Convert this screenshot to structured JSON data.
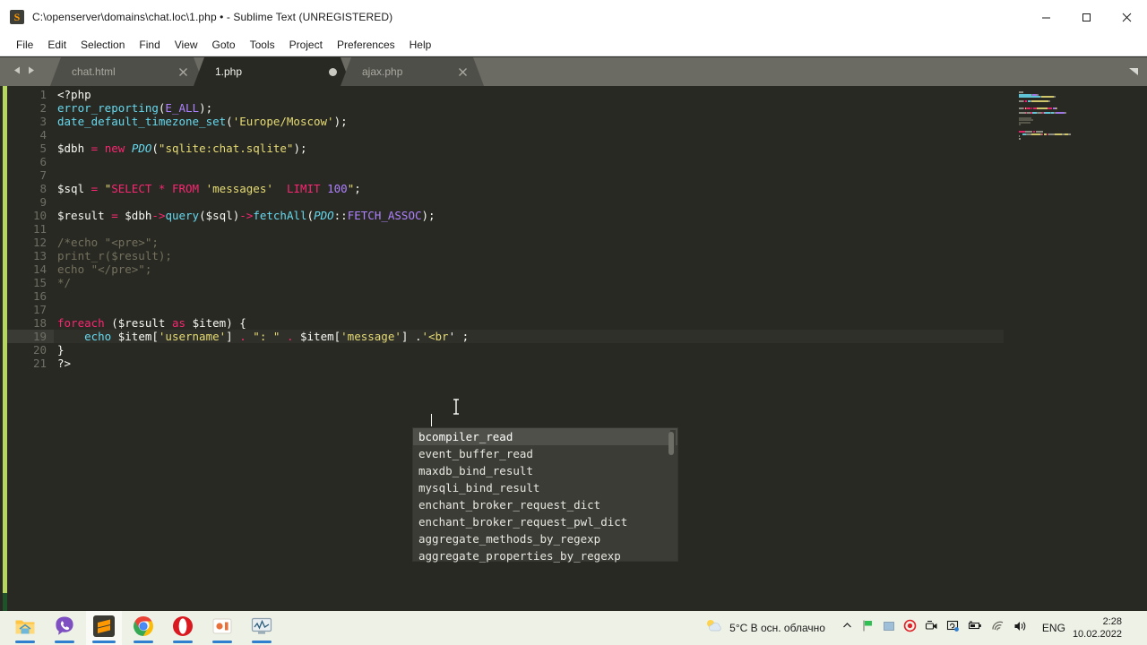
{
  "window": {
    "title": "C:\\openserver\\domains\\chat.loc\\1.php • - Sublime Text (UNREGISTERED)",
    "app_icon": "sublime-text-icon",
    "controls": {
      "minimize": "minimize-icon",
      "maximize": "maximize-icon",
      "close": "close-icon"
    }
  },
  "menubar": {
    "items": [
      {
        "label": "File"
      },
      {
        "label": "Edit"
      },
      {
        "label": "Selection"
      },
      {
        "label": "Find"
      },
      {
        "label": "View"
      },
      {
        "label": "Goto"
      },
      {
        "label": "Tools"
      },
      {
        "label": "Project"
      },
      {
        "label": "Preferences"
      },
      {
        "label": "Help"
      }
    ]
  },
  "tabbar": {
    "nav_prev_icon": "chevron-left-icon",
    "nav_next_icon": "chevron-right-icon",
    "overflow_icon": "chevron-down-icon",
    "tabs": [
      {
        "label": "chat.html",
        "active": false,
        "dirty": false,
        "close_icon": "close-icon"
      },
      {
        "label": "1.php",
        "active": true,
        "dirty": true,
        "close_icon": "dirty-dot-icon"
      },
      {
        "label": "ajax.php",
        "active": false,
        "dirty": false,
        "close_icon": "close-icon"
      }
    ]
  },
  "editor": {
    "active_line": 19,
    "cursor_column_text": "after <br",
    "lines": [
      {
        "n": "1",
        "tokens": [
          {
            "t": "def",
            "s": "<?php"
          }
        ]
      },
      {
        "n": "2",
        "tokens": [
          {
            "t": "fn",
            "s": "error_reporting"
          },
          {
            "t": "punct",
            "s": "("
          },
          {
            "t": "const",
            "s": "E_ALL"
          },
          {
            "t": "punct",
            "s": ");"
          }
        ]
      },
      {
        "n": "3",
        "tokens": [
          {
            "t": "fn",
            "s": "date_default_timezone_set"
          },
          {
            "t": "punct",
            "s": "("
          },
          {
            "t": "str",
            "s": "'Europe/Moscow'"
          },
          {
            "t": "punct",
            "s": ");"
          }
        ]
      },
      {
        "n": "4",
        "tokens": []
      },
      {
        "n": "5",
        "tokens": [
          {
            "t": "var",
            "s": "$dbh "
          },
          {
            "t": "op",
            "s": "="
          },
          {
            "t": "var",
            "s": " "
          },
          {
            "t": "kw",
            "s": "new"
          },
          {
            "t": "var",
            "s": " "
          },
          {
            "t": "cls",
            "s": "PDO"
          },
          {
            "t": "punct",
            "s": "("
          },
          {
            "t": "str",
            "s": "\"sqlite:chat.sqlite\""
          },
          {
            "t": "punct",
            "s": ");"
          }
        ]
      },
      {
        "n": "6",
        "tokens": []
      },
      {
        "n": "7",
        "tokens": []
      },
      {
        "n": "8",
        "tokens": [
          {
            "t": "var",
            "s": "$sql "
          },
          {
            "t": "op",
            "s": "="
          },
          {
            "t": "var",
            "s": " "
          },
          {
            "t": "str",
            "s": "\""
          },
          {
            "t": "kw",
            "s": "SELECT"
          },
          {
            "t": "str",
            "s": " "
          },
          {
            "t": "op",
            "s": "*"
          },
          {
            "t": "str",
            "s": " "
          },
          {
            "t": "kw",
            "s": "FROM"
          },
          {
            "t": "str",
            "s": " 'messages'  "
          },
          {
            "t": "kw",
            "s": "LIMIT"
          },
          {
            "t": "str",
            "s": " "
          },
          {
            "t": "const",
            "s": "100"
          },
          {
            "t": "str",
            "s": "\""
          },
          {
            "t": "punct",
            "s": ";"
          }
        ]
      },
      {
        "n": "9",
        "tokens": []
      },
      {
        "n": "10",
        "tokens": [
          {
            "t": "var",
            "s": "$result "
          },
          {
            "t": "op",
            "s": "="
          },
          {
            "t": "var",
            "s": " $dbh"
          },
          {
            "t": "op",
            "s": "->"
          },
          {
            "t": "fn",
            "s": "query"
          },
          {
            "t": "punct",
            "s": "("
          },
          {
            "t": "var",
            "s": "$sql"
          },
          {
            "t": "punct",
            "s": ")"
          },
          {
            "t": "op",
            "s": "->"
          },
          {
            "t": "fn",
            "s": "fetchAll"
          },
          {
            "t": "punct",
            "s": "("
          },
          {
            "t": "cls",
            "s": "PDO"
          },
          {
            "t": "punct",
            "s": "::"
          },
          {
            "t": "const",
            "s": "FETCH_ASSOC"
          },
          {
            "t": "punct",
            "s": ");"
          }
        ]
      },
      {
        "n": "11",
        "tokens": []
      },
      {
        "n": "12",
        "tokens": [
          {
            "t": "cmt",
            "s": "/*echo \"<pre>\";"
          }
        ]
      },
      {
        "n": "13",
        "tokens": [
          {
            "t": "cmt",
            "s": "print_r($result);"
          }
        ]
      },
      {
        "n": "14",
        "tokens": [
          {
            "t": "cmt",
            "s": "echo \"</pre>\";"
          }
        ]
      },
      {
        "n": "15",
        "tokens": [
          {
            "t": "cmt",
            "s": "*/"
          }
        ]
      },
      {
        "n": "16",
        "tokens": []
      },
      {
        "n": "17",
        "tokens": []
      },
      {
        "n": "18",
        "tokens": [
          {
            "t": "kw",
            "s": "foreach"
          },
          {
            "t": "def",
            "s": " ("
          },
          {
            "t": "var",
            "s": "$result"
          },
          {
            "t": "def",
            "s": " "
          },
          {
            "t": "kw",
            "s": "as"
          },
          {
            "t": "def",
            "s": " "
          },
          {
            "t": "var",
            "s": "$item"
          },
          {
            "t": "def",
            "s": ") {"
          }
        ]
      },
      {
        "n": "19",
        "tokens": [
          {
            "t": "def",
            "s": "    "
          },
          {
            "t": "fn",
            "s": "echo"
          },
          {
            "t": "def",
            "s": " $item["
          },
          {
            "t": "str",
            "s": "'username'"
          },
          {
            "t": "def",
            "s": "] "
          },
          {
            "t": "op",
            "s": "."
          },
          {
            "t": "def",
            "s": " "
          },
          {
            "t": "str",
            "s": "\": \""
          },
          {
            "t": "def",
            "s": " "
          },
          {
            "t": "op",
            "s": "."
          },
          {
            "t": "def",
            "s": " $item["
          },
          {
            "t": "str",
            "s": "'message'"
          },
          {
            "t": "def",
            "s": "] ."
          },
          {
            "t": "str",
            "s": "'<br"
          },
          {
            "t": "def",
            "s": "' ;"
          }
        ]
      },
      {
        "n": "20",
        "tokens": [
          {
            "t": "def",
            "s": "}"
          }
        ]
      },
      {
        "n": "21",
        "tokens": [
          {
            "t": "def",
            "s": "?>"
          }
        ]
      }
    ]
  },
  "autocomplete": {
    "items": [
      {
        "label": "bcompiler_read",
        "selected": true
      },
      {
        "label": "event_buffer_read",
        "selected": false
      },
      {
        "label": "maxdb_bind_result",
        "selected": false
      },
      {
        "label": "mysqli_bind_result",
        "selected": false
      },
      {
        "label": "enchant_broker_request_dict",
        "selected": false
      },
      {
        "label": "enchant_broker_request_pwl_dict",
        "selected": false
      },
      {
        "label": "aggregate_methods_by_regexp",
        "selected": false
      },
      {
        "label": "aggregate_properties_by_regexp",
        "selected": false
      }
    ]
  },
  "taskbar": {
    "apps": [
      {
        "name": "file-explorer",
        "running": true,
        "active": false
      },
      {
        "name": "viber",
        "running": true,
        "active": false
      },
      {
        "name": "sublime-text",
        "running": true,
        "active": true
      },
      {
        "name": "google-chrome",
        "running": true,
        "active": false
      },
      {
        "name": "opera",
        "running": true,
        "active": false
      },
      {
        "name": "openserver",
        "running": true,
        "active": false
      },
      {
        "name": "system-monitor",
        "running": true,
        "active": false
      }
    ],
    "weather": {
      "icon": "partly-cloudy-sun-icon",
      "temperature": "5°C",
      "condition": "В осн. облачно"
    },
    "tray": [
      {
        "name": "show-hidden-icons-icon"
      },
      {
        "name": "security-flag-icon"
      },
      {
        "name": "blue-square-icon"
      },
      {
        "name": "opera-record-icon"
      },
      {
        "name": "camera-icon"
      },
      {
        "name": "sync-photo-icon"
      },
      {
        "name": "battery-icon"
      },
      {
        "name": "wifi-icon"
      },
      {
        "name": "volume-icon"
      }
    ],
    "language": "ENG",
    "clock": {
      "time": "2:28",
      "date": "10.02.2022"
    }
  },
  "colors": {
    "editor_bg": "#282923",
    "tabbar_bg": "#6b6b63",
    "titlebar_bg": "#ffffff",
    "taskbar_bg": "#eef1e6",
    "accent_modified": "#b5d75f",
    "autocomplete_bg": "#3b3c36",
    "keyword": "#f92672",
    "string": "#e6db74",
    "function": "#66d9ef",
    "comment": "#75715e",
    "constant": "#ae81ff"
  }
}
